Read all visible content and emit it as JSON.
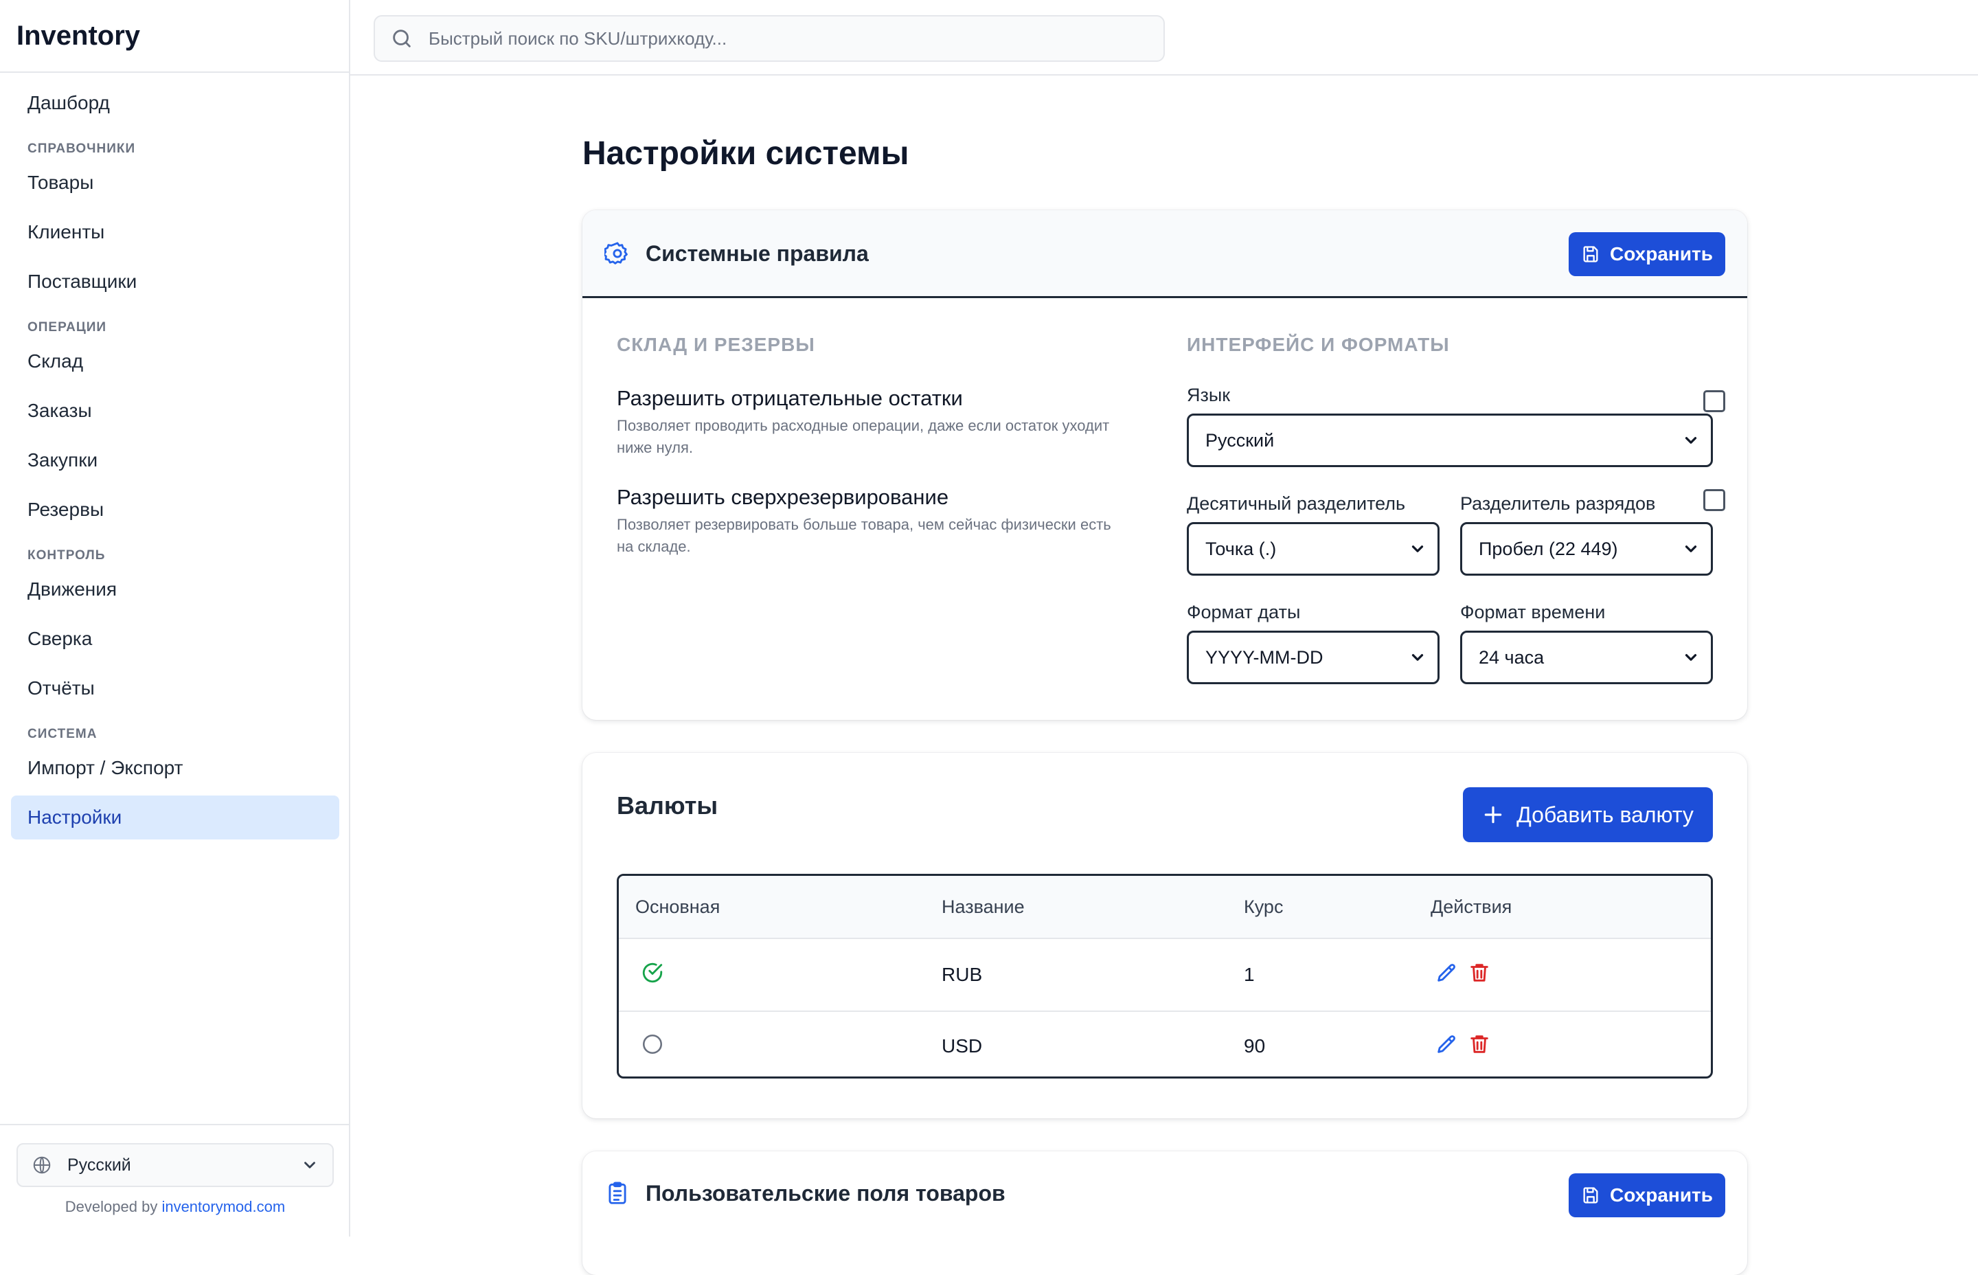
{
  "app": {
    "title": "Inventory"
  },
  "sidebar": {
    "items": [
      {
        "type": "item",
        "label": "Дашборд"
      },
      {
        "type": "group",
        "label": "СПРАВОЧНИКИ"
      },
      {
        "type": "item",
        "label": "Товары"
      },
      {
        "type": "item",
        "label": "Клиенты"
      },
      {
        "type": "item",
        "label": "Поставщики"
      },
      {
        "type": "group",
        "label": "ОПЕРАЦИИ"
      },
      {
        "type": "item",
        "label": "Склад"
      },
      {
        "type": "item",
        "label": "Заказы"
      },
      {
        "type": "item",
        "label": "Закупки"
      },
      {
        "type": "item",
        "label": "Резервы"
      },
      {
        "type": "group",
        "label": "КОНТРОЛЬ"
      },
      {
        "type": "item",
        "label": "Движения"
      },
      {
        "type": "item",
        "label": "Сверка"
      },
      {
        "type": "item",
        "label": "Отчёты"
      },
      {
        "type": "group",
        "label": "СИСТЕМА"
      },
      {
        "type": "item",
        "label": "Импорт / Экспорт"
      },
      {
        "type": "item",
        "label": "Настройки",
        "active": true
      }
    ],
    "language": "Русский",
    "developed_prefix": "Developed by ",
    "developed_link": "inventorymod.com"
  },
  "search": {
    "placeholder": "Быстрый поиск по SKU/штрихкоду..."
  },
  "page": {
    "title": "Настройки системы"
  },
  "system_rules": {
    "title": "Системные правила",
    "save_label": "Сохранить",
    "warehouse_section": "СКЛАД И РЕЗЕРВЫ",
    "options": [
      {
        "title": "Разрешить отрицательные остатки",
        "desc": "Позволяет проводить расходные операции, даже если остаток уходит ниже нуля.",
        "checked": false
      },
      {
        "title": "Разрешить сверхрезервирование",
        "desc": "Позволяет резервировать больше товара, чем сейчас физически есть на складе.",
        "checked": false
      }
    ],
    "interface_section": "ИНТЕРФЕЙС И ФОРМАТЫ",
    "language_label": "Язык",
    "language_value": "Русский",
    "decimal_label": "Десятичный разделитель",
    "decimal_value": "Точка (.)",
    "thousands_label": "Разделитель разрядов",
    "thousands_value": "Пробел (22 449)",
    "date_label": "Формат даты",
    "date_value": "YYYY-MM-DD",
    "time_label": "Формат времени",
    "time_value": "24 часа"
  },
  "currencies": {
    "title": "Валюты",
    "add_label": "Добавить валюту",
    "columns": [
      "Основная",
      "Название",
      "Курс",
      "Действия"
    ],
    "rows": [
      {
        "primary": true,
        "name": "RUB",
        "rate": "1"
      },
      {
        "primary": false,
        "name": "USD",
        "rate": "90"
      }
    ]
  },
  "custom_fields": {
    "title": "Пользовательские поля товаров",
    "save_label": "Сохранить"
  },
  "colors": {
    "accent": "#1d4ed8",
    "active_nav_bg": "#dbeafe",
    "success": "#16a34a",
    "danger": "#dc2626"
  }
}
